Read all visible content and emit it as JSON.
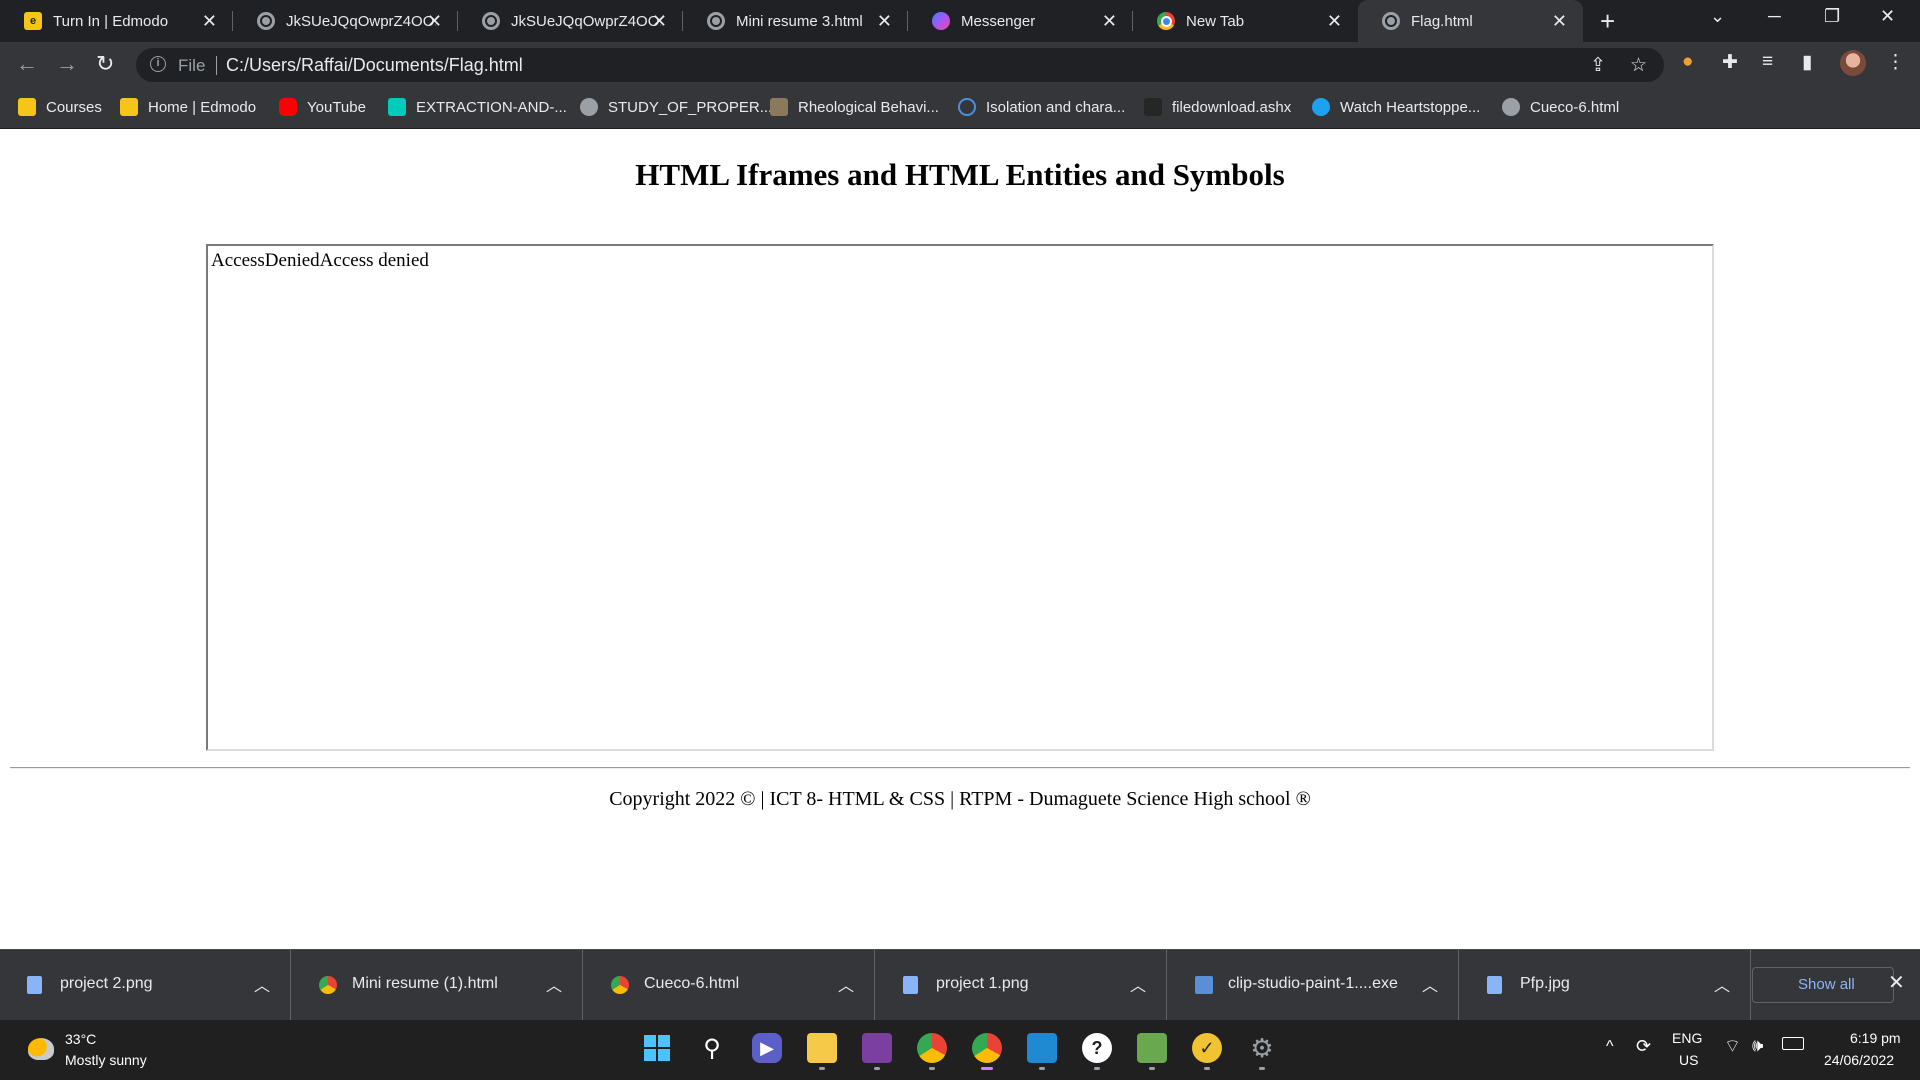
{
  "tabs": [
    {
      "title": "Turn In | Edmodo",
      "favicon": "edmodo-icon",
      "active": false
    },
    {
      "title": "JkSUeJQqOwprZ4OO...",
      "favicon": "globe-icon",
      "active": false
    },
    {
      "title": "JkSUeJQqOwprZ4OO...",
      "favicon": "globe-icon",
      "active": false
    },
    {
      "title": "Mini resume 3.html",
      "favicon": "globe-icon",
      "active": false
    },
    {
      "title": "Messenger",
      "favicon": "messenger-icon",
      "active": false
    },
    {
      "title": "New Tab",
      "favicon": "chrome-icon",
      "active": false
    },
    {
      "title": "Flag.html",
      "favicon": "globe-icon",
      "active": true
    }
  ],
  "toolbar": {
    "scheme": "File",
    "url": "C:/Users/Raffai/Documents/Flag.html"
  },
  "bookmarks": [
    {
      "label": "Courses",
      "icon": "courses-icon",
      "color": "#f5c518"
    },
    {
      "label": "Home | Edmodo",
      "icon": "edmodo-icon",
      "color": "#f5c518"
    },
    {
      "label": "YouTube",
      "icon": "youtube-icon",
      "color": "#ff0000"
    },
    {
      "label": "EXTRACTION-AND-...",
      "icon": "researchgate-icon",
      "color": "#00ccbb"
    },
    {
      "label": "STUDY_OF_PROPER...",
      "icon": "globe-icon",
      "color": "#9aa0a6"
    },
    {
      "label": "Rheological Behavi...",
      "icon": "document-icon",
      "color": "#8a7a5a"
    },
    {
      "label": "Isolation and chara...",
      "icon": "search-icon",
      "color": "#4a90e2"
    },
    {
      "label": "filedownload.ashx",
      "icon": "blackboard-icon",
      "color": "#262626"
    },
    {
      "label": "Watch Heartstoppe...",
      "icon": "play-icon",
      "color": "#1da1f2"
    },
    {
      "label": "Cueco-6.html",
      "icon": "globe-icon",
      "color": "#9aa0a6"
    }
  ],
  "page": {
    "heading": "HTML Iframes and HTML Entities and Symbols",
    "iframe_text": "AccessDeniedAccess denied",
    "footer": "Copyright 2022 © | ICT 8- HTML & CSS | RTPM - Dumaguete Science High school ®"
  },
  "downloads": {
    "items": [
      {
        "name": "project 2.png",
        "icon": "image-file-icon"
      },
      {
        "name": "Mini resume (1).html",
        "icon": "chrome-file-icon"
      },
      {
        "name": "Cueco-6.html",
        "icon": "chrome-file-icon"
      },
      {
        "name": "project 1.png",
        "icon": "image-file-icon"
      },
      {
        "name": "clip-studio-paint-1....exe",
        "icon": "installer-file-icon"
      },
      {
        "name": "Pfp.jpg",
        "icon": "image-file-icon"
      }
    ],
    "show_all_label": "Show all"
  },
  "taskbar": {
    "weather_temp": "33°C",
    "weather_desc": "Mostly sunny",
    "language": "ENG",
    "region": "US",
    "time": "6:19 pm",
    "date": "24/06/2022"
  }
}
